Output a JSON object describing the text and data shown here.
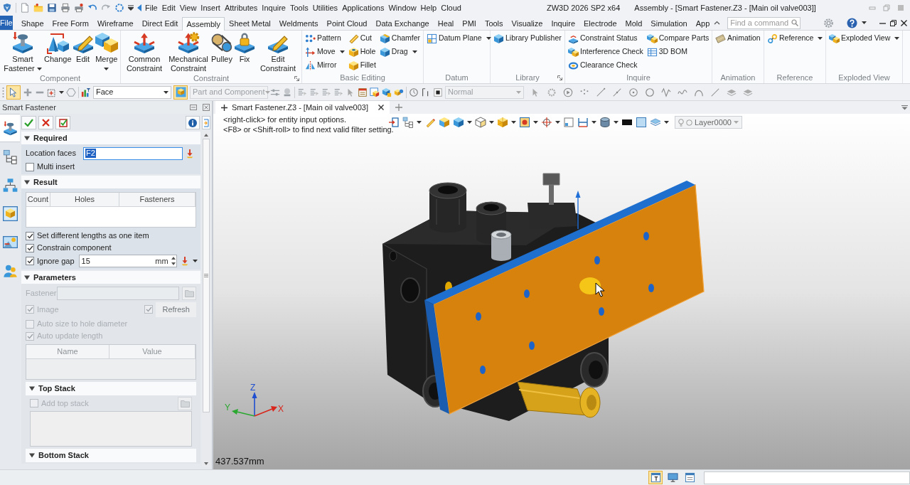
{
  "title_bar": {
    "menus": [
      "File",
      "Edit",
      "View",
      "Insert",
      "Attributes",
      "Inquire",
      "Tools",
      "Utilities",
      "Applications",
      "Window",
      "Help",
      "Cloud"
    ],
    "app_title": "ZW3D 2026 SP2 x64",
    "document_title": "Assembly - [Smart Fastener.Z3 - [Main oil valve003]]"
  },
  "ribbon_tabs": [
    {
      "label": "File",
      "kind": "app_menu",
      "selected": false
    },
    {
      "label": "Shape",
      "kind": "tab",
      "selected": false
    },
    {
      "label": "Free Form",
      "kind": "tab",
      "selected": false
    },
    {
      "label": "Wireframe",
      "kind": "tab",
      "selected": false
    },
    {
      "label": "Direct Edit",
      "kind": "tab",
      "selected": false
    },
    {
      "label": "Assembly",
      "kind": "tab",
      "selected": true
    },
    {
      "label": "Sheet Metal",
      "kind": "tab",
      "selected": false
    },
    {
      "label": "Weldments",
      "kind": "tab",
      "selected": false
    },
    {
      "label": "Point Cloud",
      "kind": "tab",
      "selected": false
    },
    {
      "label": "Data Exchange",
      "kind": "tab",
      "selected": false
    },
    {
      "label": "Heal",
      "kind": "tab",
      "selected": false
    },
    {
      "label": "PMI",
      "kind": "tab",
      "selected": false
    },
    {
      "label": "Tools",
      "kind": "tab",
      "selected": false
    },
    {
      "label": "Visualize",
      "kind": "tab",
      "selected": false
    },
    {
      "label": "Inquire",
      "kind": "tab",
      "selected": false
    },
    {
      "label": "Electrode",
      "kind": "tab",
      "selected": false
    },
    {
      "label": "Mold",
      "kind": "tab",
      "selected": false
    },
    {
      "label": "Simulation",
      "kind": "tab",
      "selected": false
    },
    {
      "label": "App",
      "kind": "tab",
      "selected": false
    }
  ],
  "command_search": {
    "placeholder": "Find a command"
  },
  "ribbon_groups": [
    {
      "title": "Component",
      "launcher": false,
      "commands": [
        {
          "label": "Smart Fastener",
          "dropdown": true
        },
        {
          "label": "Change",
          "dropdown": false
        },
        {
          "label": "Edit",
          "dropdown": false
        },
        {
          "label": "Merge",
          "dropdown": true
        }
      ]
    },
    {
      "title": "Constraint",
      "launcher": true,
      "commands": [
        {
          "label": "Common Constraint",
          "dropdown": false
        },
        {
          "label": "Mechanical Constraint",
          "dropdown": false
        },
        {
          "label": "Pulley",
          "dropdown": false
        },
        {
          "label": "Fix",
          "dropdown": false
        },
        {
          "label": "Edit Constraint",
          "dropdown": false
        }
      ]
    },
    {
      "title": "Basic Editing",
      "launcher": false,
      "stacks": [
        [
          {
            "label": "Pattern",
            "dropdown": false
          },
          {
            "label": "Move",
            "dropdown": true
          },
          {
            "label": "Mirror",
            "dropdown": false
          }
        ],
        [
          {
            "label": "Cut",
            "dropdown": false
          },
          {
            "label": "Hole",
            "dropdown": false
          },
          {
            "label": "Fillet",
            "dropdown": false
          }
        ],
        [
          {
            "label": "Chamfer",
            "dropdown": false
          },
          {
            "label": "Drag",
            "dropdown": true
          }
        ]
      ]
    },
    {
      "title": "Datum",
      "launcher": false,
      "stacks": [
        [
          {
            "label": "Datum Plane",
            "dropdown": true
          }
        ]
      ]
    },
    {
      "title": "Library",
      "launcher": true,
      "stacks": [
        [
          {
            "label": "Library Publisher",
            "dropdown": false
          }
        ]
      ]
    },
    {
      "title": "Inquire",
      "launcher": false,
      "stacks": [
        [
          {
            "label": "Constraint Status",
            "dropdown": false
          },
          {
            "label": "Interference Check",
            "dropdown": false
          },
          {
            "label": "Clearance Check",
            "dropdown": false
          }
        ],
        [
          {
            "label": "Compare Parts",
            "dropdown": false
          },
          {
            "label": "3D BOM",
            "dropdown": false
          }
        ]
      ]
    },
    {
      "title": "Animation",
      "launcher": false,
      "stacks": [
        [
          {
            "label": "Animation",
            "dropdown": false
          }
        ]
      ]
    },
    {
      "title": "Reference",
      "launcher": false,
      "stacks": [
        [
          {
            "label": "Reference",
            "dropdown": true
          }
        ]
      ]
    },
    {
      "title": "Exploded View",
      "launcher": false,
      "stacks": [
        [
          {
            "label": "Exploded View",
            "dropdown": true
          }
        ]
      ]
    }
  ],
  "toolbar": {
    "pick_on": true,
    "selection_filter": {
      "value": "Face",
      "disabled": false
    },
    "filter_on": true,
    "component_filter": {
      "value": "Part and Component",
      "disabled": true
    },
    "display_mode": {
      "value": "Normal",
      "disabled": true
    }
  },
  "side_tabs": [
    {
      "selected": true
    },
    {
      "selected": false
    },
    {
      "selected": false
    },
    {
      "selected": false
    },
    {
      "selected": false
    },
    {
      "selected": false
    }
  ],
  "panel": {
    "title": "Smart Fastener",
    "sections": [
      {
        "title": "Required",
        "expanded": true,
        "disabled": false,
        "rows": [
          {
            "kind": "field",
            "label": "Location faces",
            "value": "F2",
            "value_selected": true
          },
          {
            "kind": "checkbox",
            "label": "Multi insert",
            "checked": false
          }
        ]
      },
      {
        "title": "Result",
        "expanded": true,
        "disabled": false,
        "rows": [
          {
            "kind": "table",
            "columns": [
              "Count",
              "Holes",
              "Fasteners"
            ]
          },
          {
            "kind": "checkbox",
            "label": "Set different lengths as one item",
            "checked": true
          },
          {
            "kind": "checkbox",
            "label": "Constrain component",
            "checked": true
          },
          {
            "kind": "gap",
            "label": "Ignore gap",
            "checked": true,
            "value": "15",
            "unit": "mm"
          }
        ]
      },
      {
        "title": "Parameters",
        "expanded": true,
        "disabled": true,
        "rows": [
          {
            "kind": "file",
            "label": "Fastener"
          },
          {
            "kind": "image",
            "label": "Image",
            "checked": true,
            "second_checked": true,
            "button": "Refresh"
          },
          {
            "kind": "checkbox",
            "label": "Auto size to hole diameter",
            "checked": false
          },
          {
            "kind": "checkbox",
            "label": "Auto update length",
            "checked": true
          },
          {
            "kind": "table",
            "columns": [
              "Name",
              "Value"
            ]
          },
          {
            "kind": "subsection",
            "title": "Top Stack",
            "expanded": true,
            "add_label": "Add top stack",
            "checked": false
          },
          {
            "kind": "subsection",
            "title": "Bottom Stack",
            "expanded": true
          }
        ]
      }
    ]
  },
  "document_tabs": [
    {
      "label": "Smart Fastener.Z3 - [Main oil valve003]",
      "selected": true
    }
  ],
  "viewport": {
    "hints": [
      "<right-click> for entity input options.",
      "<F8> or <Shift-roll> to find next valid filter setting."
    ],
    "layer": {
      "value": "Layer0000"
    },
    "axes": [
      "Z",
      "Y",
      "X"
    ],
    "scale": "437.537mm"
  },
  "status_bar": {
    "view_buttons": [
      {
        "selected": true
      },
      {
        "selected": false
      },
      {
        "selected": false
      }
    ]
  }
}
